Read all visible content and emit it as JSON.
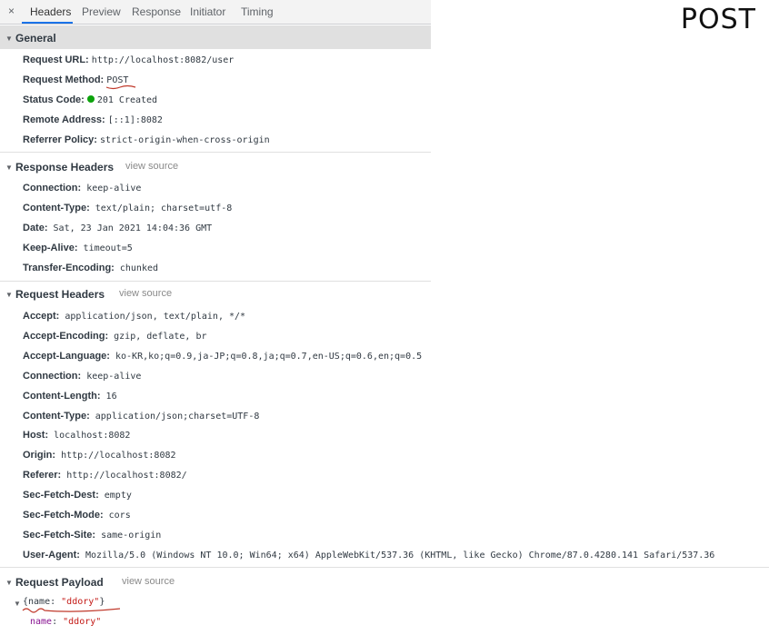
{
  "tabs": {
    "close": "×",
    "items": [
      "Headers",
      "Preview",
      "Response",
      "Initiator",
      "Timing"
    ]
  },
  "annotation": "POST",
  "general": {
    "title": "General",
    "request_url": {
      "key": "Request URL:",
      "value": "http://localhost:8082/user"
    },
    "request_method": {
      "key": "Request Method:",
      "value": "POST"
    },
    "status_code": {
      "key": "Status Code:",
      "value": "201 Created"
    },
    "remote_address": {
      "key": "Remote Address:",
      "value": "[::1]:8082"
    },
    "referrer_policy": {
      "key": "Referrer Policy:",
      "value": "strict-origin-when-cross-origin"
    }
  },
  "response_headers": {
    "title": "Response Headers",
    "view_source": "view source",
    "rows": [
      {
        "key": "Connection:",
        "value": "keep-alive"
      },
      {
        "key": "Content-Type:",
        "value": "text/plain; charset=utf-8"
      },
      {
        "key": "Date:",
        "value": "Sat, 23 Jan 2021 14:04:36 GMT"
      },
      {
        "key": "Keep-Alive:",
        "value": "timeout=5"
      },
      {
        "key": "Transfer-Encoding:",
        "value": "chunked"
      }
    ]
  },
  "request_headers": {
    "title": "Request Headers",
    "view_source": "view source",
    "rows": [
      {
        "key": "Accept:",
        "value": "application/json, text/plain, */*"
      },
      {
        "key": "Accept-Encoding:",
        "value": "gzip, deflate, br"
      },
      {
        "key": "Accept-Language:",
        "value": "ko-KR,ko;q=0.9,ja-JP;q=0.8,ja;q=0.7,en-US;q=0.6,en;q=0.5"
      },
      {
        "key": "Connection:",
        "value": "keep-alive"
      },
      {
        "key": "Content-Length:",
        "value": "16"
      },
      {
        "key": "Content-Type:",
        "value": "application/json;charset=UTF-8"
      },
      {
        "key": "Host:",
        "value": "localhost:8082"
      },
      {
        "key": "Origin:",
        "value": "http://localhost:8082"
      },
      {
        "key": "Referer:",
        "value": "http://localhost:8082/"
      },
      {
        "key": "Sec-Fetch-Dest:",
        "value": "empty"
      },
      {
        "key": "Sec-Fetch-Mode:",
        "value": "cors"
      },
      {
        "key": "Sec-Fetch-Site:",
        "value": "same-origin"
      },
      {
        "key": "User-Agent:",
        "value": "Mozilla/5.0 (Windows NT 10.0; Win64; x64) AppleWebKit/537.36 (KHTML, like Gecko) Chrome/87.0.4280.141 Safari/537.36"
      }
    ]
  },
  "request_payload": {
    "title": "Request Payload",
    "view_source": "view source",
    "summary_open": "{name: ",
    "summary_value": "\"ddory\"",
    "summary_close": "}",
    "prop_key": "name",
    "prop_sep": ": ",
    "prop_value": "\"ddory\""
  },
  "colors": {
    "active_tab_underline": "#1a73e8",
    "status_ok_dot": "#0ca30c",
    "annotation_ink": "#c0392b"
  }
}
